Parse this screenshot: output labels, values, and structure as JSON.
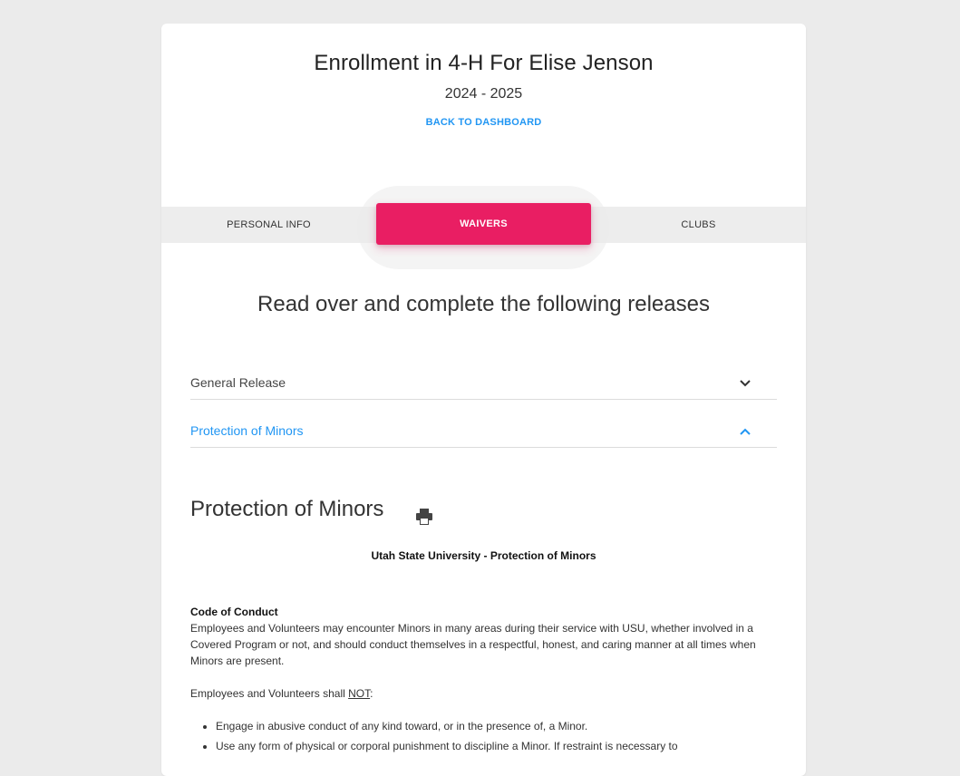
{
  "header": {
    "title": "Enrollment in 4-H For Elise Jenson",
    "year": "2024 - 2025",
    "back_link": "BACK TO DASHBOARD"
  },
  "tabs": [
    {
      "label": "PERSONAL INFO",
      "active": false
    },
    {
      "label": "WAIVERS",
      "active": true
    },
    {
      "label": "CLUBS",
      "active": false
    }
  ],
  "section_heading": "Read over and complete the following releases",
  "accordion": [
    {
      "label": "General Release",
      "expanded": false
    },
    {
      "label": "Protection of Minors",
      "expanded": true
    }
  ],
  "document": {
    "title": "Protection of Minors",
    "subtitle": "Utah State University - Protection of Minors",
    "code_heading": "Code of Conduct",
    "code_text": "Employees and Volunteers may encounter Minors in many areas during their service with USU, whether involved in a Covered Program or not, and should conduct themselves in a respectful, honest, and caring manner at all times when Minors are present.",
    "shall_prefix": "Employees and Volunteers shall ",
    "shall_not": "NOT",
    "shall_suffix": ":",
    "bullets": [
      "Engage in abusive conduct of any kind toward, or in the presence of, a Minor.",
      "Use any form of physical or corporal punishment to discipline a Minor. If restraint is necessary to"
    ]
  },
  "colors": {
    "accent": "#e91e63",
    "link": "#2196f3",
    "background": "#ebebeb"
  },
  "icons": {
    "print": "print-icon",
    "chevron_down": "chevron-down-icon",
    "chevron_up": "chevron-up-icon"
  }
}
